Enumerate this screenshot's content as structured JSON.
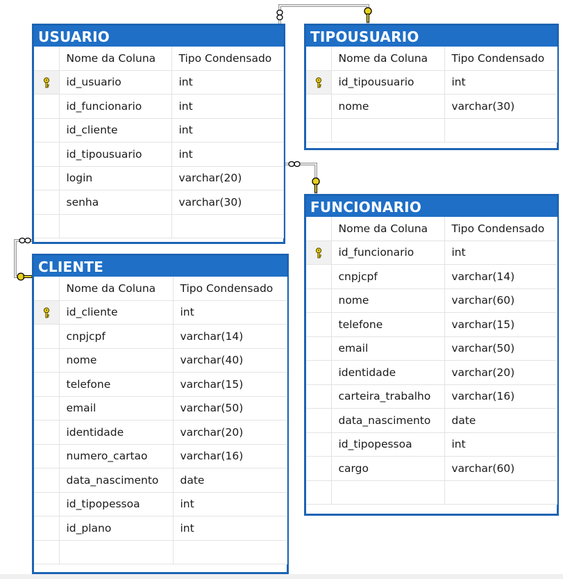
{
  "column_headers": {
    "name": "Nome da Coluna",
    "type": "Tipo Condensado"
  },
  "tables": {
    "usuario": {
      "title": "USUARIO",
      "columns": [
        {
          "name": "id_usuario",
          "type": "int",
          "pk": true
        },
        {
          "name": "id_funcionario",
          "type": "int"
        },
        {
          "name": "id_cliente",
          "type": "int"
        },
        {
          "name": "id_tipousuario",
          "type": "int"
        },
        {
          "name": "login",
          "type": "varchar(20)"
        },
        {
          "name": "senha",
          "type": "varchar(30)"
        }
      ]
    },
    "tipousuario": {
      "title": "TIPOUSUARIO",
      "columns": [
        {
          "name": "id_tipousuario",
          "type": "int",
          "pk": true
        },
        {
          "name": "nome",
          "type": "varchar(30)"
        }
      ]
    },
    "cliente": {
      "title": "CLIENTE",
      "columns": [
        {
          "name": "id_cliente",
          "type": "int",
          "pk": true
        },
        {
          "name": "cnpjcpf",
          "type": "varchar(14)"
        },
        {
          "name": "nome",
          "type": "varchar(40)"
        },
        {
          "name": "telefone",
          "type": "varchar(15)"
        },
        {
          "name": "email",
          "type": "varchar(50)"
        },
        {
          "name": "identidade",
          "type": "varchar(20)"
        },
        {
          "name": "numero_cartao",
          "type": "varchar(16)"
        },
        {
          "name": "data_nascimento",
          "type": "date"
        },
        {
          "name": "id_tipopessoa",
          "type": "int"
        },
        {
          "name": "id_plano",
          "type": "int"
        }
      ]
    },
    "funcionario": {
      "title": "FUNCIONARIO",
      "columns": [
        {
          "name": "id_funcionario",
          "type": "int",
          "pk": true
        },
        {
          "name": "cnpjcpf",
          "type": "varchar(14)"
        },
        {
          "name": "nome",
          "type": "varchar(60)"
        },
        {
          "name": "telefone",
          "type": "varchar(15)"
        },
        {
          "name": "email",
          "type": "varchar(50)"
        },
        {
          "name": "identidade",
          "type": "varchar(20)"
        },
        {
          "name": "carteira_trabalho",
          "type": "varchar(16)"
        },
        {
          "name": "data_nascimento",
          "type": "date"
        },
        {
          "name": "id_tipopessoa",
          "type": "int"
        },
        {
          "name": "cargo",
          "type": "varchar(60)"
        }
      ]
    }
  },
  "relationships": [
    {
      "from": "usuario",
      "to": "tipousuario",
      "many_icon": "infinity-icon",
      "one_icon": "key-icon"
    },
    {
      "from": "usuario",
      "to": "funcionario",
      "many_icon": "infinity-icon",
      "one_icon": "key-icon"
    },
    {
      "from": "usuario",
      "to": "cliente",
      "many_icon": "infinity-icon",
      "one_icon": "key-icon"
    }
  ],
  "colors": {
    "header_bg": "#1f6fc6",
    "border": "#1c64b4",
    "key": "#e8d21a"
  }
}
